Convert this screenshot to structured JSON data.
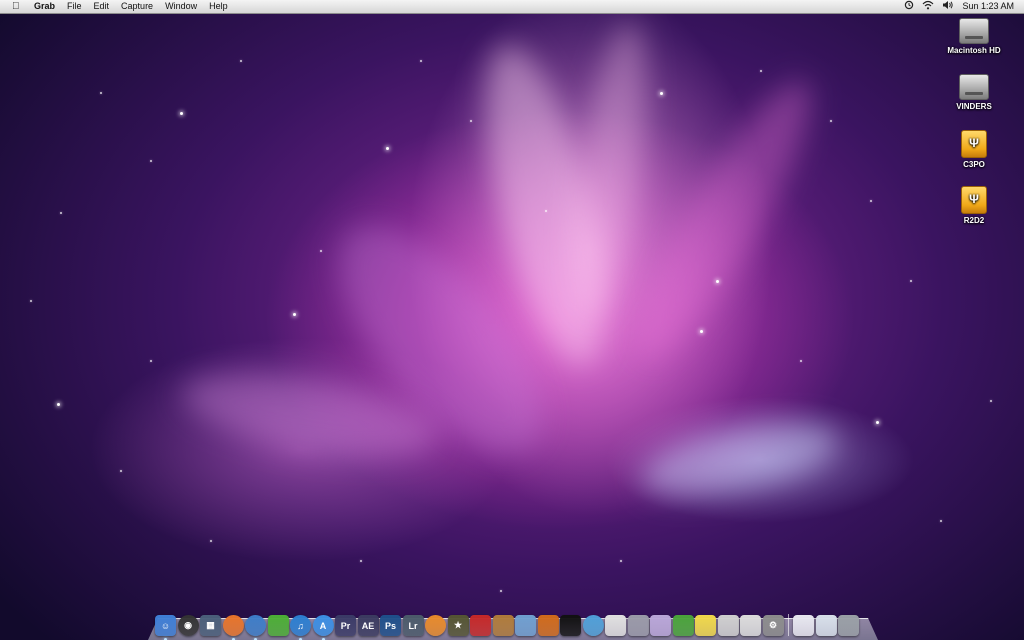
{
  "menubar": {
    "apple_icon": "apple-logo-icon",
    "app_name": "Grab",
    "menus": [
      "File",
      "Edit",
      "Capture",
      "Window",
      "Help"
    ],
    "status_icons": [
      "time-machine-icon",
      "wifi-icon",
      "volume-icon"
    ],
    "clock": "Sun 1:23 AM"
  },
  "desktop": {
    "icons": [
      {
        "label": "Macintosh HD",
        "icon": "hard-drive-icon"
      },
      {
        "label": "VINDERS",
        "icon": "hard-drive-icon"
      },
      {
        "label": "C3PO",
        "icon": "usb-drive-icon"
      },
      {
        "label": "R2D2",
        "icon": "usb-drive-icon"
      }
    ],
    "wallpaper": "aurora-galaxy"
  },
  "dock": {
    "items": [
      {
        "name": "finder",
        "glyph": "☺",
        "color": "#3f7fd6"
      },
      {
        "name": "dashboard",
        "glyph": "◉",
        "color": "#333333"
      },
      {
        "name": "spaces",
        "glyph": "▦",
        "color": "#4a5f7a"
      },
      {
        "name": "firefox",
        "glyph": "",
        "color": "#e8742a"
      },
      {
        "name": "thunderbird",
        "glyph": "",
        "color": "#3d7dc8"
      },
      {
        "name": "adium",
        "glyph": "",
        "color": "#4cae35"
      },
      {
        "name": "itunes",
        "glyph": "♫",
        "color": "#2c7fd1"
      },
      {
        "name": "app-store",
        "glyph": "A",
        "color": "#3b8fe4"
      },
      {
        "name": "premiere",
        "glyph": "Pr",
        "color": "#3a3a66"
      },
      {
        "name": "after-effects",
        "glyph": "AE",
        "color": "#3b3b60"
      },
      {
        "name": "photoshop",
        "glyph": "Ps",
        "color": "#1e4f8a"
      },
      {
        "name": "lightroom",
        "glyph": "Lr",
        "color": "#4b5b6a"
      },
      {
        "name": "blender",
        "glyph": "",
        "color": "#e88a2a"
      },
      {
        "name": "imovie-star",
        "glyph": "★",
        "color": "#555533"
      },
      {
        "name": "red-app",
        "glyph": "",
        "color": "#c62828"
      },
      {
        "name": "garageband",
        "glyph": "",
        "color": "#b07b3a"
      },
      {
        "name": "preview",
        "glyph": "",
        "color": "#6f9fd0"
      },
      {
        "name": "growl",
        "glyph": "",
        "color": "#d06a1a"
      },
      {
        "name": "dvd-player",
        "glyph": "",
        "color": "#111111"
      },
      {
        "name": "safari-like",
        "glyph": "",
        "color": "#4fa0d8"
      },
      {
        "name": "textedit",
        "glyph": "",
        "color": "#e0e0e0"
      },
      {
        "name": "utilities",
        "glyph": "",
        "color": "#9a9aa8"
      },
      {
        "name": "dropbox-box",
        "glyph": "",
        "color": "#b9a6d8"
      },
      {
        "name": "leaf-app",
        "glyph": "",
        "color": "#4aa43a"
      },
      {
        "name": "stickies",
        "glyph": "",
        "color": "#f0d84a"
      },
      {
        "name": "script-editor",
        "glyph": "",
        "color": "#cfcfcf"
      },
      {
        "name": "boot-camp",
        "glyph": "",
        "color": "#dcdcdc"
      },
      {
        "name": "system-preferences",
        "glyph": "⚙",
        "color": "#8c8c8c"
      },
      {
        "name": "mail-stack",
        "glyph": "",
        "color": "#e8e8f0"
      },
      {
        "name": "documents-stack",
        "glyph": "",
        "color": "#d8e0ea"
      },
      {
        "name": "trash",
        "glyph": "",
        "color": "#9aa0a6"
      }
    ],
    "running": [
      "finder",
      "firefox",
      "thunderbird",
      "itunes",
      "app-store"
    ]
  }
}
